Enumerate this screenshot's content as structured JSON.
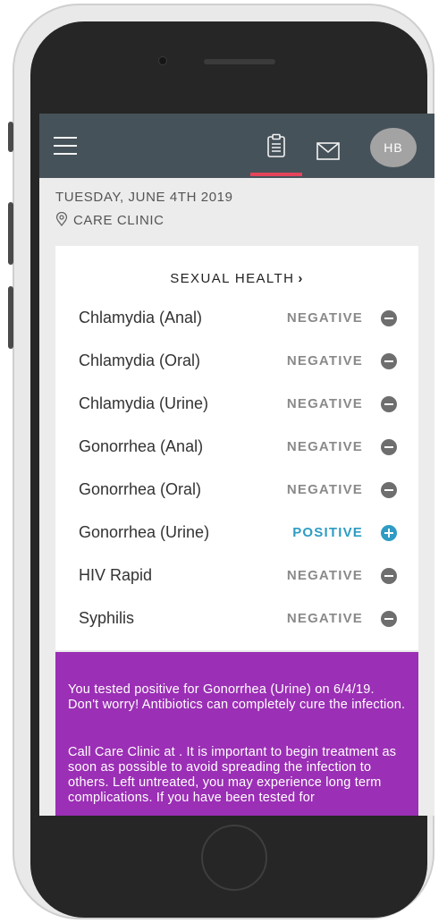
{
  "header": {
    "menu_icon": "hamburger-icon",
    "nav_icons": [
      "clipboard-icon",
      "envelope-icon"
    ],
    "avatar_initials": "HB"
  },
  "visit": {
    "date": "TUESDAY, JUNE 4TH 2019",
    "location": "CARE CLINIC",
    "location_icon": "map-pin-icon"
  },
  "results": {
    "section_title": "SEXUAL HEALTH",
    "tests": [
      {
        "name": "Chlamydia (Anal)",
        "result": "NEGATIVE"
      },
      {
        "name": "Chlamydia (Oral)",
        "result": "NEGATIVE"
      },
      {
        "name": "Chlamydia (Urine)",
        "result": "NEGATIVE"
      },
      {
        "name": "Gonorrhea (Anal)",
        "result": "NEGATIVE"
      },
      {
        "name": "Gonorrhea (Oral)",
        "result": "NEGATIVE"
      },
      {
        "name": "Gonorrhea (Urine)",
        "result": "POSITIVE"
      },
      {
        "name": "HIV Rapid",
        "result": "NEGATIVE"
      },
      {
        "name": "Syphilis",
        "result": "NEGATIVE"
      }
    ]
  },
  "notice": {
    "paragraph_1": "You tested positive for Gonorrhea (Urine) on 6/4/19. Don't worry! Antibiotics can completely cure the infection.",
    "paragraph_2": "Call Care Clinic at . It is important to begin treatment as soon as possible to avoid spreading the infection to others. Left untreated, you may experience long term complications. If you have been tested for"
  },
  "colors": {
    "topbar": "#46525a",
    "active_tab_indicator": "#e4445a",
    "positive": "#2e9cc4",
    "negative": "#8a8a8a",
    "notice_background": "#9b2fb5"
  }
}
